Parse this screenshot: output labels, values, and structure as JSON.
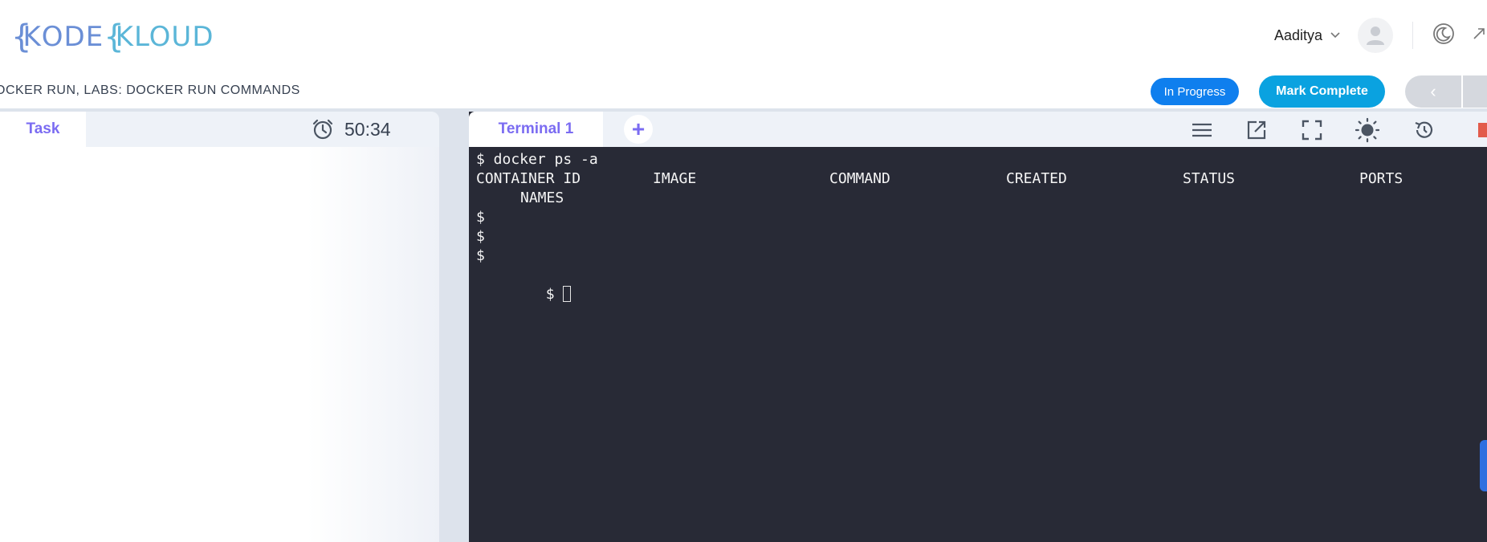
{
  "logo": {
    "word1": "ODE",
    "word2": "LOUD",
    "brace1": "{",
    "brace2": "{",
    "k1": "K",
    "k2": "K"
  },
  "user": {
    "name": "Aaditya"
  },
  "breadcrumb": "OCKER RUN, LABS: DOCKER RUN COMMANDS",
  "actions": {
    "in_progress": "In Progress",
    "mark_complete": "Mark Complete",
    "prev": "‹"
  },
  "task": {
    "tab_label": "Task",
    "timer": "50:34"
  },
  "terminal": {
    "tab_label": "Terminal 1",
    "add_tab": "+",
    "prompt_cmd": "$ docker ps -a",
    "headers": [
      "CONTAINER ID",
      "IMAGE",
      "COMMAND",
      "CREATED",
      "STATUS",
      "PORTS"
    ],
    "header_wrap": "NAMES",
    "prompts": [
      "$",
      "$",
      "$",
      "$"
    ]
  },
  "colors": {
    "accent": "#7b6cf2",
    "in_progress": "#0f7fee",
    "mark_complete": "#0aa2e0",
    "terminal_bg": "#282a36"
  }
}
